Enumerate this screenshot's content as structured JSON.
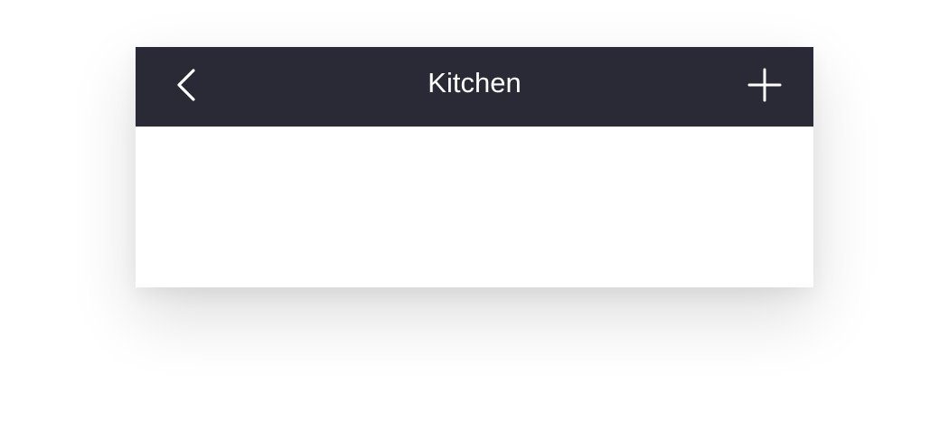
{
  "navbar": {
    "title": "Kitchen",
    "back_icon": "chevron-left-icon",
    "add_icon": "plus-icon",
    "background_color": "#2a2a36",
    "text_color": "#ffffff"
  }
}
